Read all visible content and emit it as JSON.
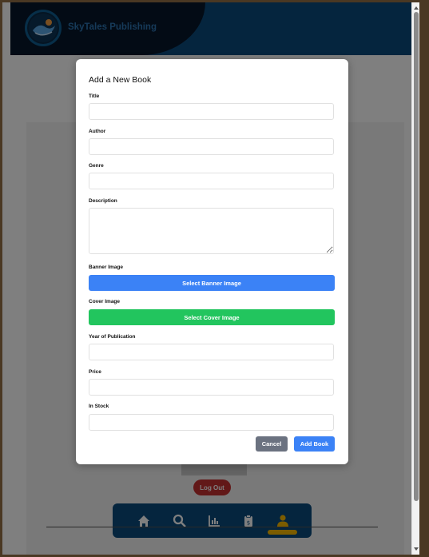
{
  "header": {
    "brand": "SkyTales Publishing"
  },
  "page": {
    "logout_label": "Log Out"
  },
  "bottom_nav": {
    "items": [
      {
        "icon": "home-icon"
      },
      {
        "icon": "search-icon"
      },
      {
        "icon": "chart-icon"
      },
      {
        "icon": "clipboard-icon"
      },
      {
        "icon": "user-icon"
      }
    ],
    "active_index": 4,
    "active_color": "#f6b800"
  },
  "modal": {
    "title": "Add a New Book",
    "fields": {
      "title": {
        "label": "Title",
        "value": ""
      },
      "author": {
        "label": "Author",
        "value": ""
      },
      "genre": {
        "label": "Genre",
        "value": ""
      },
      "description": {
        "label": "Description",
        "value": ""
      },
      "banner_image": {
        "label": "Banner Image",
        "button": "Select Banner Image"
      },
      "cover_image": {
        "label": "Cover Image",
        "button": "Select Cover Image"
      },
      "year": {
        "label": "Year of Publication",
        "value": ""
      },
      "price": {
        "label": "Price",
        "value": ""
      },
      "in_stock": {
        "label": "In Stock",
        "value": ""
      }
    },
    "cancel_label": "Cancel",
    "submit_label": "Add Book"
  },
  "colors": {
    "header_bg": "#0b4a7d",
    "header_dark": "#07172b",
    "primary": "#3b82f6",
    "success": "#22c55e",
    "danger": "#c53030",
    "secondary": "#6b7280"
  }
}
